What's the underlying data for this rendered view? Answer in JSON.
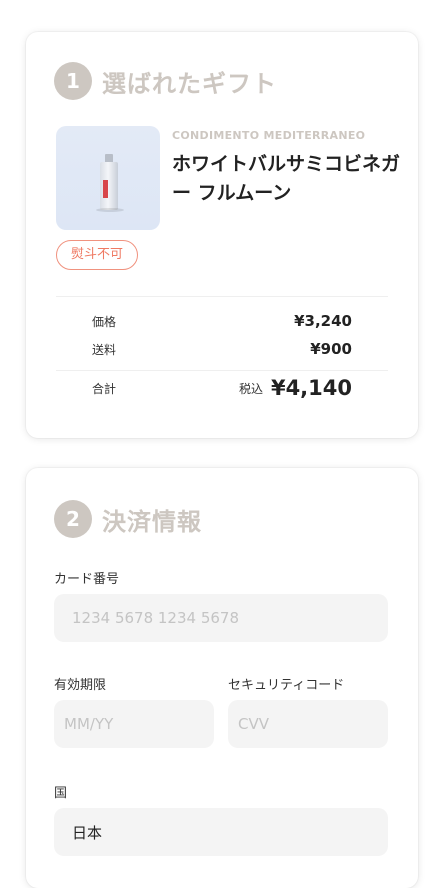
{
  "gift_section": {
    "step_number": "1",
    "title": "選ばれたギフト",
    "product": {
      "brand": "CONDIMENTO MEDITERRANEO",
      "name": "ホワイトバルサミコビネガー フルムーン",
      "image_icon": "vinegar-bottle-image"
    },
    "noshi_badge": "熨斗不可",
    "price_label": "価格",
    "price_value": "¥3,240",
    "shipping_label": "送料",
    "shipping_value": "¥900",
    "total_label": "合計",
    "tax_included_label": "税込",
    "total_value": "¥4,140"
  },
  "payment_section": {
    "step_number": "2",
    "title": "決済情報",
    "card_number_label": "カード番号",
    "card_number_placeholder": "1234 5678 1234 5678",
    "expiry_label": "有効期限",
    "expiry_placeholder": "MM/YY",
    "cvv_label": "セキュリティコード",
    "cvv_placeholder": "CVV",
    "country_label": "国",
    "country_value": "日本"
  },
  "colors": {
    "step_badge": "#cdc7c1",
    "noshi_border": "#f0927f",
    "noshi_text": "#ef7a63",
    "input_bg": "#f4f4f4"
  }
}
